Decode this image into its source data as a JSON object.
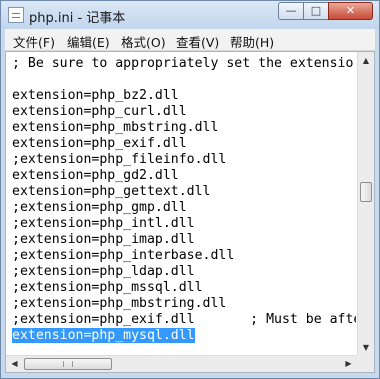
{
  "window": {
    "title": "php.ini - 记事本",
    "buttons": {
      "minimize": "—",
      "maximize": "□",
      "close": "✕"
    },
    "icon": "notepad-icon"
  },
  "menu": [
    {
      "label": "文件(F)"
    },
    {
      "label": "编辑(E)"
    },
    {
      "label": "格式(O)"
    },
    {
      "label": "查看(V)"
    },
    {
      "label": "帮助(H)"
    }
  ],
  "editor": {
    "lines": [
      "; Be sure to appropriately set the extensio",
      "",
      "extension=php_bz2.dll",
      "extension=php_curl.dll",
      "extension=php_mbstring.dll",
      "extension=php_exif.dll",
      ";extension=php_fileinfo.dll",
      "extension=php_gd2.dll",
      "extension=php_gettext.dll",
      ";extension=php_gmp.dll",
      ";extension=php_intl.dll",
      ";extension=php_imap.dll",
      ";extension=php_interbase.dll",
      ";extension=php_ldap.dll",
      ";extension=php_mssql.dll",
      ";extension=php_mbstring.dll",
      ";extension=php_exif.dll       ; Must be afte",
      "extension=php_mysql.dll"
    ],
    "selected_line_index": 17,
    "vertical_scroll_fraction": 0.45
  },
  "scrollbars": {
    "arrows": {
      "up": "▲",
      "down": "▼",
      "left": "◀",
      "right": "▶"
    }
  }
}
